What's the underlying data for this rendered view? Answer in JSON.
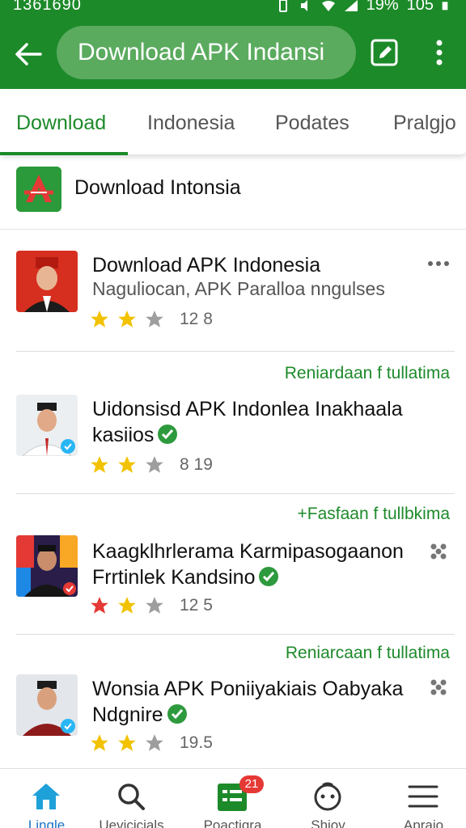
{
  "status_bar": {
    "time": "1361690",
    "battery": "19%",
    "extra": "105"
  },
  "app_bar": {
    "search_text": "Download APK Indansi"
  },
  "tabs": [
    {
      "label": "Download",
      "active": true
    },
    {
      "label": "Indonesia",
      "active": false
    },
    {
      "label": "Podates",
      "active": false
    },
    {
      "label": "Pralgjo",
      "active": false
    }
  ],
  "section": {
    "title": "Download Intonsia"
  },
  "apps": [
    {
      "name": "Download APK Indonesia",
      "subtitle": "Naguliocan, APK Paralloa nngulses",
      "rating_text": "12 8",
      "stars": 2,
      "promo": ""
    },
    {
      "name": "Uidonsisd APK Indonlea Inakhaala kasiios",
      "subtitle": "",
      "rating_text": "8 19",
      "stars": 2,
      "promo": "Reniardaan f tullatima"
    },
    {
      "name": "Kaagklhrlerama Karmipasogaanon Frrtinlek Kandsino",
      "subtitle": "",
      "rating_text": "12 5",
      "stars": 2,
      "promo": "+Fasfaan f tullbkima"
    },
    {
      "name": "Wonsia APK Poniiyakiais Oabyaka Ndgnire",
      "subtitle": "",
      "rating_text": "19.5",
      "stars": 2,
      "promo": "Reniarcaan f tullatima"
    }
  ],
  "bottom_nav": [
    {
      "label": "Lingle",
      "icon": "home-icon",
      "active": true
    },
    {
      "label": "Uevicicials",
      "icon": "search-icon",
      "active": false
    },
    {
      "label": "Poactiqra",
      "icon": "list-icon",
      "active": false,
      "badge": "21"
    },
    {
      "label": "Shiov",
      "icon": "face-icon",
      "active": false
    },
    {
      "label": "Apraio",
      "icon": "menu-icon",
      "active": false
    }
  ],
  "colors": {
    "primary": "#1d8a2a",
    "accent_blue": "#1a73c8",
    "star_yellow": "#f2c200",
    "star_red": "#e53935",
    "star_gray": "#9e9e9e"
  }
}
